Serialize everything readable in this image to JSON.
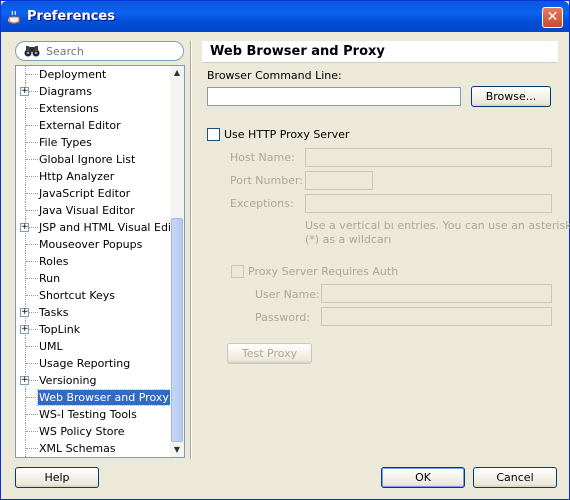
{
  "window": {
    "title": "Preferences",
    "close_glyph": "✕"
  },
  "search": {
    "placeholder": "Search"
  },
  "tree": {
    "items": [
      {
        "label": "Deployment",
        "expandable": false
      },
      {
        "label": "Diagrams",
        "expandable": true
      },
      {
        "label": "Extensions",
        "expandable": false
      },
      {
        "label": "External Editor",
        "expandable": false
      },
      {
        "label": "File Types",
        "expandable": false
      },
      {
        "label": "Global Ignore List",
        "expandable": false
      },
      {
        "label": "Http Analyzer",
        "expandable": false
      },
      {
        "label": "JavaScript Editor",
        "expandable": false
      },
      {
        "label": "Java Visual Editor",
        "expandable": false
      },
      {
        "label": "JSP and HTML Visual Editor",
        "expandable": true
      },
      {
        "label": "Mouseover Popups",
        "expandable": false
      },
      {
        "label": "Roles",
        "expandable": false
      },
      {
        "label": "Run",
        "expandable": false
      },
      {
        "label": "Shortcut Keys",
        "expandable": false
      },
      {
        "label": "Tasks",
        "expandable": true
      },
      {
        "label": "TopLink",
        "expandable": true
      },
      {
        "label": "UML",
        "expandable": false
      },
      {
        "label": "Usage Reporting",
        "expandable": false
      },
      {
        "label": "Versioning",
        "expandable": true
      },
      {
        "label": "Web Browser and Proxy",
        "expandable": false,
        "selected": true
      },
      {
        "label": "WS-I Testing Tools",
        "expandable": false
      },
      {
        "label": "WS Policy Store",
        "expandable": false
      },
      {
        "label": "XML Schemas",
        "expandable": false
      }
    ]
  },
  "panel": {
    "title": "Web Browser and Proxy",
    "browser_cmd_label": "Browser Command Line:",
    "browser_cmd_value": "",
    "browse_label": "Browse...",
    "use_proxy_label": "Use HTTP Proxy Server",
    "use_proxy_checked": false,
    "host_label": "Host Name:",
    "port_label": "Port Number:",
    "exceptions_label": "Exceptions:",
    "exceptions_hint_1": "Use a vertical bı entries.  You can use an asterisk",
    "exceptions_hint_2": "(*) as a wildcarı",
    "auth_label": "Proxy Server Requires Auth",
    "user_label": "User Name:",
    "password_label": "Password:",
    "test_proxy_label": "Test Proxy"
  },
  "footer": {
    "help_label": "Help",
    "ok_label": "OK",
    "cancel_label": "Cancel"
  }
}
